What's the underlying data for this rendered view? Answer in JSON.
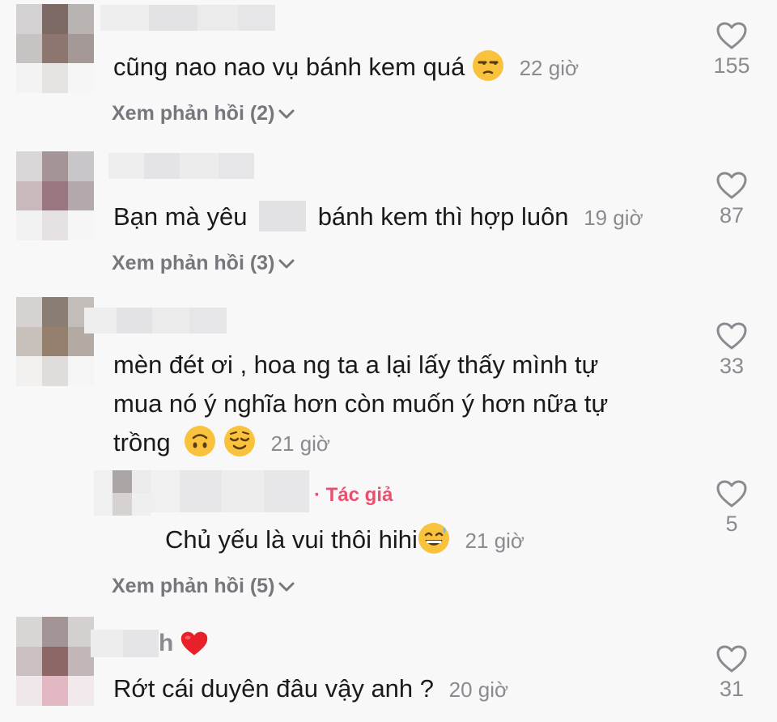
{
  "comments": [
    {
      "text": "cũng nao nao vụ bánh kem quá",
      "time": "22 giờ",
      "replies_label": "Xem phản hồi (2)",
      "likes": "155",
      "emoji": [
        "unamused-face"
      ]
    },
    {
      "text_before": "Bạn mà yêu",
      "text_after": "bánh kem thì hợp luôn",
      "time": "19 giờ",
      "replies_label": "Xem phản hồi (3)",
      "likes": "87"
    },
    {
      "line1": "mèn đét ơi , hoa ng ta a lại lấy thấy mình tự",
      "line2": "mua nó ý nghĩa hơn còn muốn ý hơn nữa tự",
      "line3": "trồng",
      "time": "21 giờ",
      "replies_label": "Xem phản hồi (5)",
      "likes": "33",
      "emoji": [
        "upside-down-face",
        "relieved-face"
      ],
      "reply": {
        "author_badge": "· Tác giả",
        "text": "Chủ yếu là vui thôi hihi",
        "time": "21 giờ",
        "likes": "5",
        "emoji": [
          "grinning-sweat-face"
        ]
      }
    },
    {
      "name_suffix": "h",
      "text": "Rớt cái duyên đâu vậy anh ?",
      "time": "20 giờ",
      "likes": "31",
      "emoji": [
        "red-heart"
      ]
    }
  ],
  "colors": {
    "background": "#f8f8f8",
    "text": "#1a1a1a",
    "secondary": "#8a8b91",
    "author_badge": "#e94f6e",
    "heart_emoji": "#e8202a"
  }
}
